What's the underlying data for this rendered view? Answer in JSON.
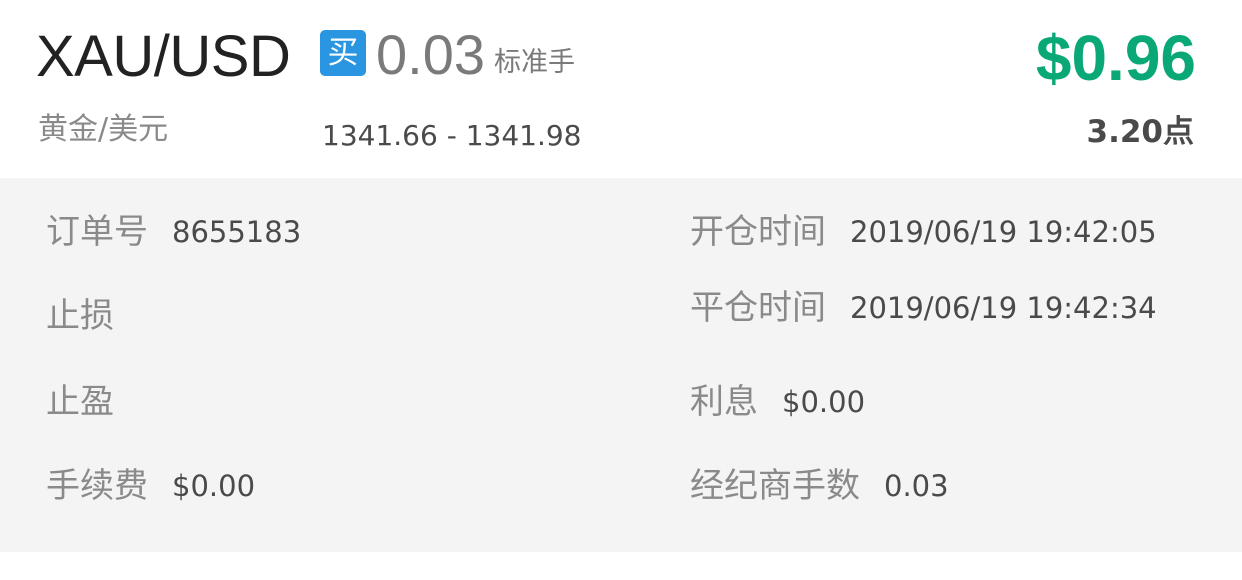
{
  "header": {
    "symbol": "XAU/USD",
    "side": "买",
    "volume": "0.03",
    "lot_unit": "标准手",
    "profit": "$0.96",
    "symbol_name": "黄金/美元",
    "price_range": "1341.66 - 1341.98",
    "points": "3.20点"
  },
  "details": {
    "order_id_label": "订单号",
    "order_id": "8655183",
    "open_time_label": "开仓时间",
    "open_time": "2019/06/19 19:42:05",
    "stop_loss_label": "止损",
    "close_time_label": "平仓时间",
    "close_time": "2019/06/19 19:42:34",
    "take_profit_label": "止盈",
    "swap_label": "利息",
    "swap": "$0.00",
    "commission_label": "手续费",
    "commission": "$0.00",
    "broker_lots_label": "经纪商手数",
    "broker_lots": "0.03"
  },
  "colors": {
    "profit": "#0aa876",
    "buy_badge": "#2a95e0",
    "details_background": "#f4f4f4"
  }
}
